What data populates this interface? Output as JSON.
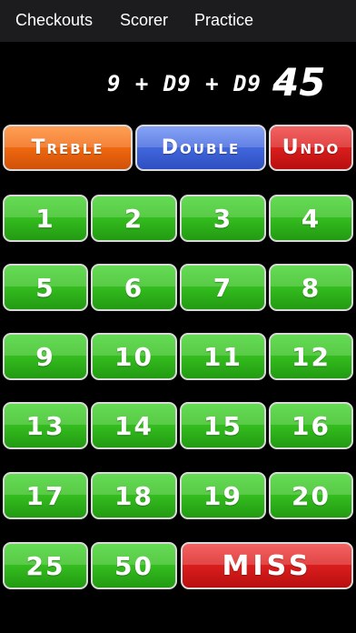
{
  "nav": {
    "checkouts": "Checkouts",
    "scorer": "Scorer",
    "practice": "Practice"
  },
  "score": {
    "equation": "9 + D9 + D9 =",
    "total": "45"
  },
  "modifiers": {
    "treble": "Treble",
    "double": "Double",
    "undo": "Undo"
  },
  "numbers": [
    "1",
    "2",
    "3",
    "4",
    "5",
    "6",
    "7",
    "8",
    "9",
    "10",
    "11",
    "12",
    "13",
    "14",
    "15",
    "16",
    "17",
    "18",
    "19",
    "20"
  ],
  "bull": {
    "outer": "25",
    "inner": "50"
  },
  "miss": "MISS",
  "colors": {
    "green": "#36c020",
    "orange": "#f26a10",
    "blue": "#4469e0",
    "red": "#dd1f1f",
    "background": "#000000"
  }
}
